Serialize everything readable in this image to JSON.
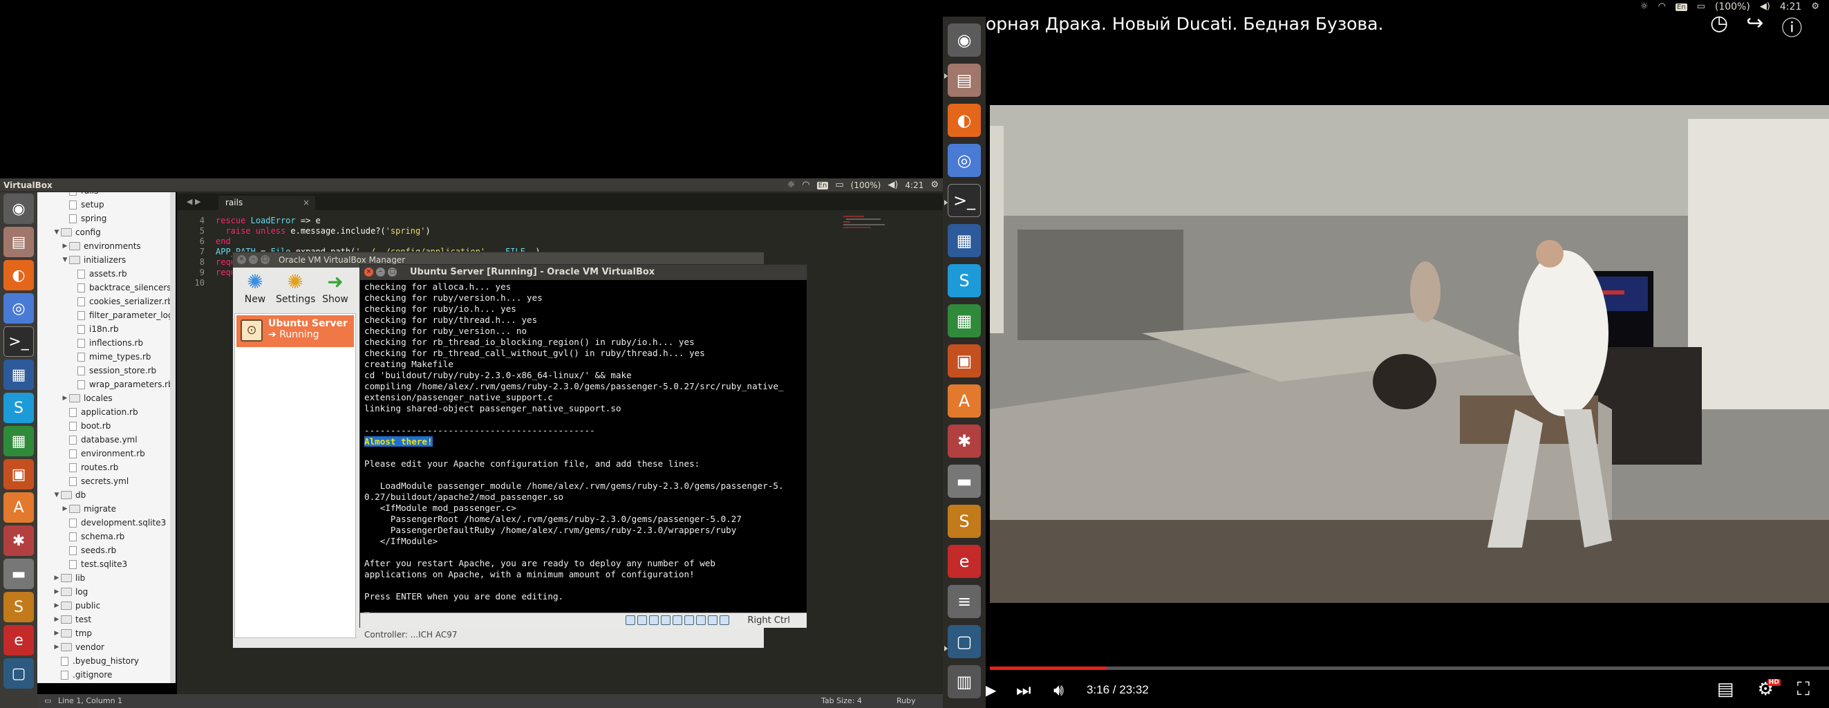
{
  "left": {
    "window_title": "VirtualBox",
    "tray": {
      "keyboard": "En",
      "battery": "(100%)",
      "clock": "4:21"
    },
    "sidebar_tree": [
      {
        "label": "rails",
        "kind": "file",
        "depth": 2,
        "arrow": ""
      },
      {
        "label": "setup",
        "kind": "file",
        "depth": 2,
        "arrow": ""
      },
      {
        "label": "spring",
        "kind": "file",
        "depth": 2,
        "arrow": ""
      },
      {
        "label": "config",
        "kind": "folder",
        "depth": 1,
        "arrow": "▼"
      },
      {
        "label": "environments",
        "kind": "folder",
        "depth": 2,
        "arrow": "▶"
      },
      {
        "label": "initializers",
        "kind": "folder",
        "depth": 2,
        "arrow": "▼"
      },
      {
        "label": "assets.rb",
        "kind": "file",
        "depth": 3,
        "arrow": ""
      },
      {
        "label": "backtrace_silencers.rb",
        "kind": "file",
        "depth": 3,
        "arrow": ""
      },
      {
        "label": "cookies_serializer.rb",
        "kind": "file",
        "depth": 3,
        "arrow": ""
      },
      {
        "label": "filter_parameter_logging.rb",
        "kind": "file",
        "depth": 3,
        "arrow": ""
      },
      {
        "label": "i18n.rb",
        "kind": "file",
        "depth": 3,
        "arrow": ""
      },
      {
        "label": "inflections.rb",
        "kind": "file",
        "depth": 3,
        "arrow": ""
      },
      {
        "label": "mime_types.rb",
        "kind": "file",
        "depth": 3,
        "arrow": ""
      },
      {
        "label": "session_store.rb",
        "kind": "file",
        "depth": 3,
        "arrow": ""
      },
      {
        "label": "wrap_parameters.rb",
        "kind": "file",
        "depth": 3,
        "arrow": ""
      },
      {
        "label": "locales",
        "kind": "folder",
        "depth": 2,
        "arrow": "▶"
      },
      {
        "label": "application.rb",
        "kind": "file",
        "depth": 2,
        "arrow": ""
      },
      {
        "label": "boot.rb",
        "kind": "file",
        "depth": 2,
        "arrow": ""
      },
      {
        "label": "database.yml",
        "kind": "file",
        "depth": 2,
        "arrow": ""
      },
      {
        "label": "environment.rb",
        "kind": "file",
        "depth": 2,
        "arrow": ""
      },
      {
        "label": "routes.rb",
        "kind": "file",
        "depth": 2,
        "arrow": ""
      },
      {
        "label": "secrets.yml",
        "kind": "file",
        "depth": 2,
        "arrow": ""
      },
      {
        "label": "db",
        "kind": "folder",
        "depth": 1,
        "arrow": "▼"
      },
      {
        "label": "migrate",
        "kind": "folder",
        "depth": 2,
        "arrow": "▶"
      },
      {
        "label": "development.sqlite3",
        "kind": "file",
        "depth": 2,
        "arrow": ""
      },
      {
        "label": "schema.rb",
        "kind": "file",
        "depth": 2,
        "arrow": ""
      },
      {
        "label": "seeds.rb",
        "kind": "file",
        "depth": 2,
        "arrow": ""
      },
      {
        "label": "test.sqlite3",
        "kind": "file",
        "depth": 2,
        "arrow": ""
      },
      {
        "label": "lib",
        "kind": "folder",
        "depth": 1,
        "arrow": "▶"
      },
      {
        "label": "log",
        "kind": "folder",
        "depth": 1,
        "arrow": "▶"
      },
      {
        "label": "public",
        "kind": "folder",
        "depth": 1,
        "arrow": "▶"
      },
      {
        "label": "test",
        "kind": "folder",
        "depth": 1,
        "arrow": "▶"
      },
      {
        "label": "tmp",
        "kind": "folder",
        "depth": 1,
        "arrow": "▶"
      },
      {
        "label": "vendor",
        "kind": "folder",
        "depth": 1,
        "arrow": "▶"
      },
      {
        "label": ".byebug_history",
        "kind": "file",
        "depth": 1,
        "arrow": ""
      },
      {
        "label": ".gitignore",
        "kind": "file",
        "depth": 1,
        "arrow": ""
      }
    ],
    "editor": {
      "tab_label": "rails",
      "line_numbers": [
        "4",
        "5",
        "6",
        "7",
        "8",
        "9",
        "10"
      ],
      "code_lines": [
        "rescue LoadError => e",
        "  raise unless e.message.include?('spring')",
        "end",
        "APP_PATH = File.expand_path('../../config/application', __FILE__)",
        "require_relative '../config/boot'",
        "require 'rails/commands'",
        ""
      ]
    },
    "statusbar": {
      "position": "Line 1, Column 1",
      "tab_size": "Tab Size: 4",
      "syntax": "Ruby"
    },
    "vbox_manager": {
      "title": "Oracle VM VirtualBox Manager",
      "toolbar": [
        {
          "label": "New",
          "icon": "new-gear-icon"
        },
        {
          "label": "Settings",
          "icon": "settings-gear-icon"
        },
        {
          "label": "Show",
          "icon": "show-arrow-icon"
        }
      ],
      "vm_name": "Ubuntu Server",
      "vm_state": "Running",
      "detail_footer": "Controller: ...ICH AC97"
    },
    "vm_console": {
      "title": "Ubuntu Server [Running] - Oracle VM VirtualBox",
      "host_key": "Right Ctrl",
      "terminal_lines": [
        "checking for alloca.h... yes",
        "checking for ruby/version.h... yes",
        "checking for ruby/io.h... yes",
        "checking for ruby/thread.h... yes",
        "checking for ruby_version... no",
        "checking for rb_thread_io_blocking_region() in ruby/io.h... yes",
        "checking for rb_thread_call_without_gvl() in ruby/thread.h... yes",
        "creating Makefile",
        "cd 'buildout/ruby/ruby-2.3.0-x86_64-linux/' && make",
        "compiling /home/alex/.rvm/gems/ruby-2.3.0/gems/passenger-5.0.27/src/ruby_native_",
        "extension/passenger_native_support.c",
        "linking shared-object passenger_native_support.so",
        "",
        "--------------------------------------------",
        "",
        "Please edit your Apache configuration file, and add these lines:",
        "",
        "   LoadModule passenger_module /home/alex/.rvm/gems/ruby-2.3.0/gems/passenger-5.",
        "0.27/buildout/apache2/mod_passenger.so",
        "   <IfModule mod_passenger.c>",
        "     PassengerRoot /home/alex/.rvm/gems/ruby-2.3.0/gems/passenger-5.0.27",
        "     PassengerDefaultRuby /home/alex/.rvm/gems/ruby-2.3.0/wrappers/ruby",
        "   </IfModule>",
        "",
        "After you restart Apache, you are ready to deploy any number of web",
        "applications on Apache, with a minimum amount of configuration!",
        "",
        "Press ENTER when you are done editing."
      ],
      "highlight_line": "Almost there!"
    }
  },
  "right": {
    "tray": {
      "keyboard": "En",
      "battery": "(100%)",
      "clock": "4:21"
    },
    "video_title": "орная Драка. Новый Ducati. Бедная Бузова.",
    "player": {
      "current_time": "3:16",
      "duration": "23:32",
      "time_display": "3:16 / 23:32",
      "progress_fraction": 0.139,
      "hd_badge": "HD"
    }
  }
}
